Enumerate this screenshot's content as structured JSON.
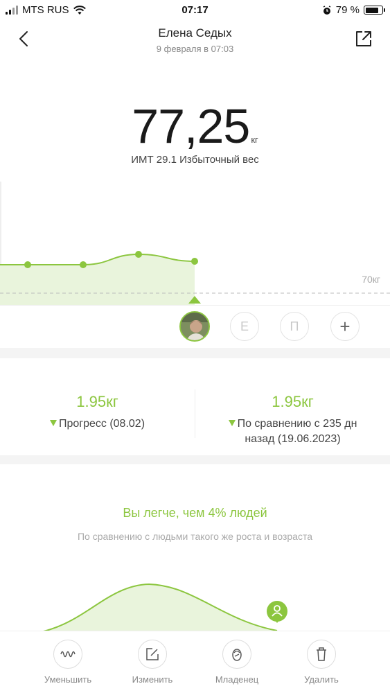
{
  "status_bar": {
    "carrier": "MTS RUS",
    "time": "07:17",
    "battery": "79 %",
    "battery_level": 0.79
  },
  "header": {
    "title": "Елена Седых",
    "subtitle": "9 февраля в 07:03",
    "back_icon": "chevron-left-icon",
    "share_icon": "share-external-icon"
  },
  "measurement": {
    "value": "77,25",
    "unit": "кг",
    "bmi_text": "ИМТ 29.1 Избыточный вес"
  },
  "chart_data": {
    "type": "area",
    "points": [
      77.2,
      77.2,
      77.35,
      77.25
    ],
    "reference_line": {
      "label": "70кг",
      "value": 70
    },
    "color": "#8cc63f"
  },
  "users": {
    "e_label": "Е",
    "p_label": "П",
    "add_label": "+"
  },
  "progress": {
    "left": {
      "value": "1.95кг",
      "label": "Прогресс (08.02)"
    },
    "right": {
      "value": "1.95кг",
      "label_line1": "По сравнению с 235 дн",
      "label_line2": "назад (19.06.2023)"
    }
  },
  "comparison": {
    "title": "Вы легче, чем 4% людей",
    "subtitle": "По сравнению с людьми такого же роста и возраста",
    "percentile": 4
  },
  "toolbar": {
    "reduce_label": "Уменьшить",
    "edit_label": "Изменить",
    "baby_label": "Младенец",
    "delete_label": "Удалить"
  },
  "colors": {
    "accent": "#8cc63f",
    "text": "#222222",
    "muted": "#888888"
  }
}
